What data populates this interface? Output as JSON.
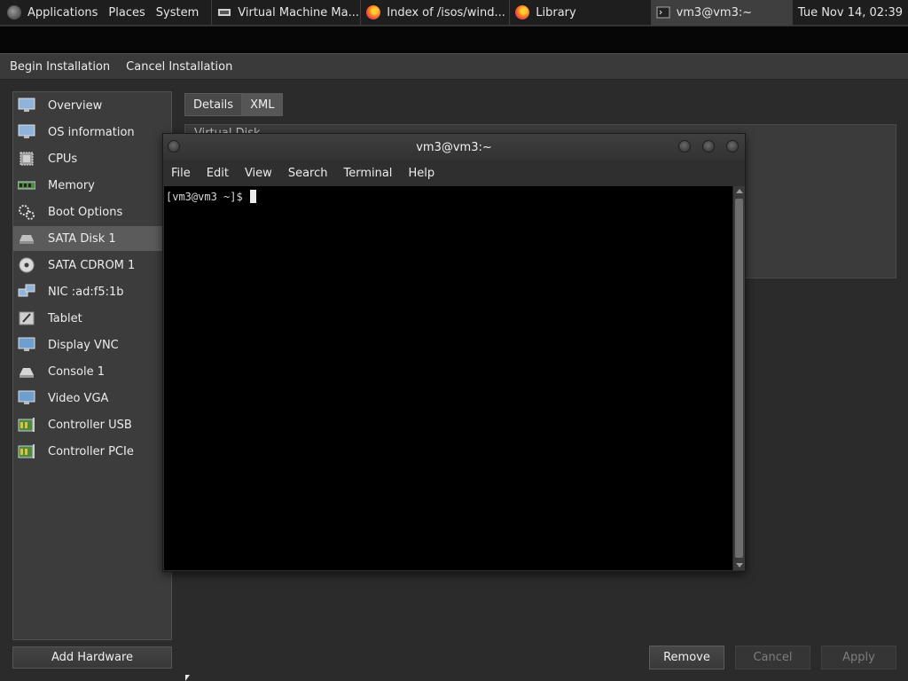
{
  "panel": {
    "menus": [
      "Applications",
      "Places",
      "System"
    ],
    "tasks": [
      {
        "label": "Virtual Machine Ma...",
        "icon": "virt-manager-icon",
        "active": false
      },
      {
        "label": "Index of /isos/wind...",
        "icon": "firefox-icon",
        "active": false
      },
      {
        "label": "Library",
        "icon": "firefox-icon",
        "active": false
      },
      {
        "label": "vm3@vm3:~",
        "icon": "terminal-icon",
        "active": true
      }
    ],
    "clock": "Tue Nov 14, 02:39"
  },
  "toolbar": {
    "begin_label": "Begin Installation",
    "cancel_label": "Cancel Installation"
  },
  "sidebar": {
    "items": [
      {
        "label": "Overview",
        "icon": "monitor-icon"
      },
      {
        "label": "OS information",
        "icon": "monitor-icon"
      },
      {
        "label": "CPUs",
        "icon": "cpu-icon"
      },
      {
        "label": "Memory",
        "icon": "memory-icon"
      },
      {
        "label": "Boot Options",
        "icon": "gears-icon"
      },
      {
        "label": "SATA Disk 1",
        "icon": "disk-icon"
      },
      {
        "label": "SATA CDROM 1",
        "icon": "cdrom-icon"
      },
      {
        "label": "NIC :ad:f5:1b",
        "icon": "network-icon"
      },
      {
        "label": "Tablet",
        "icon": "tablet-icon"
      },
      {
        "label": "Display VNC",
        "icon": "display-icon"
      },
      {
        "label": "Console 1",
        "icon": "console-icon"
      },
      {
        "label": "Video VGA",
        "icon": "video-icon"
      },
      {
        "label": "Controller USB",
        "icon": "controller-icon"
      },
      {
        "label": "Controller PCIe",
        "icon": "controller-icon"
      }
    ],
    "selected_index": 5,
    "add_hardware_label": "Add Hardware"
  },
  "tabs": {
    "details_label": "Details",
    "xml_label": "XML"
  },
  "content": {
    "frame_title": "Virtual Disk"
  },
  "buttons": {
    "remove_label": "Remove",
    "cancel_label": "Cancel",
    "apply_label": "Apply"
  },
  "terminal": {
    "title": "vm3@vm3:~",
    "menu": [
      "File",
      "Edit",
      "View",
      "Search",
      "Terminal",
      "Help"
    ],
    "prompt": "[vm3@vm3 ~]$"
  }
}
